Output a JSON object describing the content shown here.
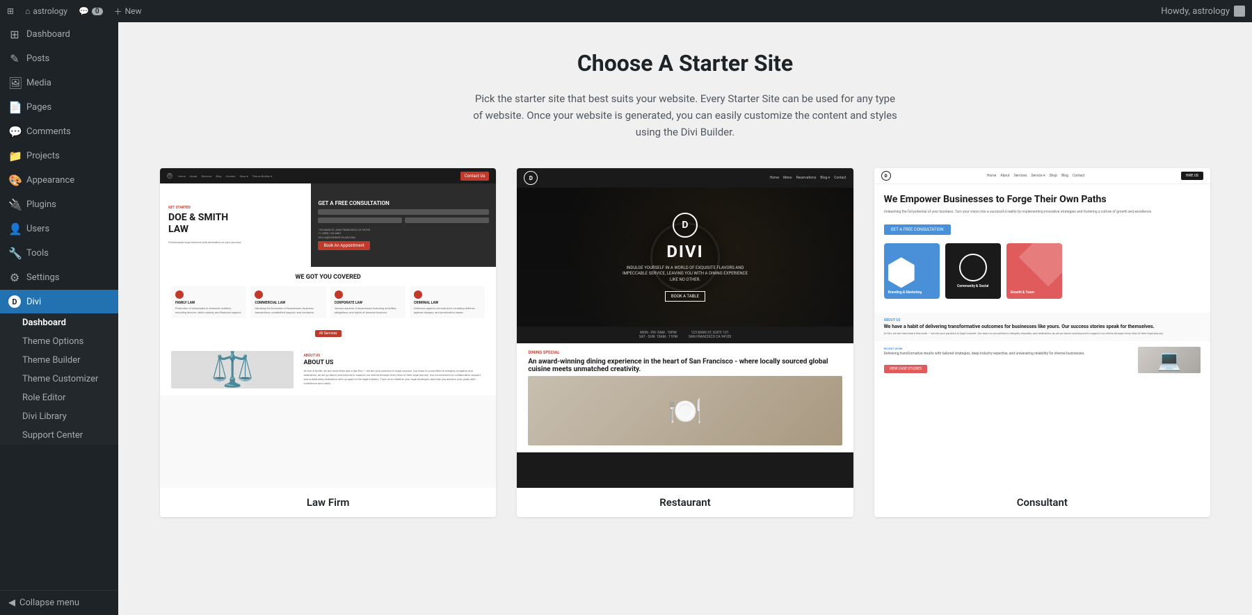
{
  "topbar": {
    "wp_icon": "⊞",
    "site_name": "astrology",
    "comments_label": "Comments",
    "comment_count": "0",
    "new_label": "New",
    "howdy_text": "Howdy, astrology"
  },
  "sidebar": {
    "site_name": "astrology",
    "home_icon": "⌂",
    "items": [
      {
        "label": "Dashboard",
        "icon": "⊞",
        "name": "dashboard"
      },
      {
        "label": "Posts",
        "icon": "✎",
        "name": "posts"
      },
      {
        "label": "Media",
        "icon": "🖼",
        "name": "media"
      },
      {
        "label": "Pages",
        "icon": "📄",
        "name": "pages"
      },
      {
        "label": "Comments",
        "icon": "💬",
        "name": "comments"
      },
      {
        "label": "Projects",
        "icon": "📁",
        "name": "projects"
      },
      {
        "label": "Appearance",
        "icon": "🎨",
        "name": "appearance"
      },
      {
        "label": "Plugins",
        "icon": "🔌",
        "name": "plugins"
      },
      {
        "label": "Users",
        "icon": "👤",
        "name": "users"
      },
      {
        "label": "Tools",
        "icon": "🔧",
        "name": "tools"
      },
      {
        "label": "Settings",
        "icon": "⚙",
        "name": "settings"
      },
      {
        "label": "Divi",
        "icon": "D",
        "name": "divi",
        "active": true
      }
    ],
    "divi_submenu": [
      {
        "label": "Dashboard",
        "name": "divi-dashboard",
        "active": true
      },
      {
        "label": "Theme Options",
        "name": "theme-options"
      },
      {
        "label": "Theme Builder",
        "name": "theme-builder"
      },
      {
        "label": "Theme Customizer",
        "name": "theme-customizer"
      },
      {
        "label": "Role Editor",
        "name": "role-editor"
      },
      {
        "label": "Divi Library",
        "name": "divi-library"
      },
      {
        "label": "Support Center",
        "name": "support-center"
      }
    ],
    "collapse_label": "Collapse menu"
  },
  "main": {
    "title": "Choose A Starter Site",
    "subtitle": "Pick the starter site that best suits your website. Every Starter Site can be used for any type of website. Once your website is generated, you can easily customize the content and styles using the Divi Builder.",
    "cards": [
      {
        "label": "Law Firm",
        "name": "law-firm"
      },
      {
        "label": "Restaurant",
        "name": "restaurant"
      },
      {
        "label": "Consultant",
        "name": "consultant"
      }
    ]
  }
}
